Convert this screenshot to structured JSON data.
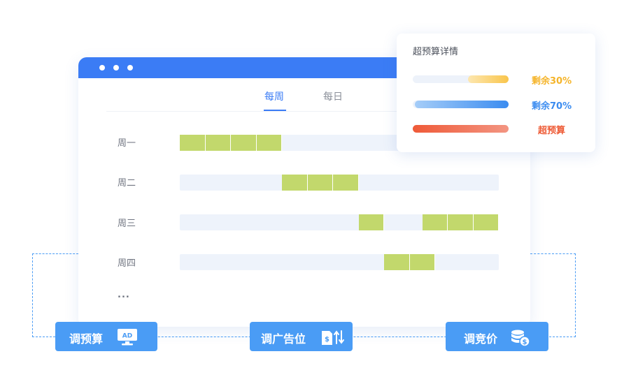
{
  "window": {
    "tabs": [
      {
        "label": "每周",
        "active": true
      },
      {
        "label": "每日",
        "active": false
      }
    ]
  },
  "schedule": {
    "rows": [
      {
        "label": "周一",
        "segments": [
          [
            0,
            4
          ]
        ]
      },
      {
        "label": "周二",
        "segments": [
          [
            4,
            7
          ]
        ]
      },
      {
        "label": "周三",
        "segments": [
          [
            7,
            8
          ],
          [
            9.5,
            12.5
          ]
        ]
      },
      {
        "label": "周四",
        "segments": [
          [
            8,
            10
          ]
        ]
      }
    ],
    "more": "..."
  },
  "budget_popup": {
    "title": "超预算详情",
    "items": [
      {
        "label": "剩余30%",
        "color": "#f5b429",
        "remaining_percent": 30,
        "fill_colors": [
          "#fde7b0",
          "#f9c54c"
        ]
      },
      {
        "label": "剩余70%",
        "color": "#3b8cf0",
        "remaining_percent": 70,
        "fill_colors": [
          "#a5cdf8",
          "#3b8cf0"
        ]
      },
      {
        "label": "超预算",
        "color": "#ee5a35",
        "remaining_percent": 0,
        "fill_colors": [
          "#ef5a38",
          "#f39582"
        ]
      }
    ]
  },
  "actions": {
    "adjust_budget": "调预算",
    "adjust_placement": "调广告位",
    "adjust_bid": "调竞价",
    "ad_icon_text": "AD"
  },
  "colors": {
    "accent": "#3b7cf5",
    "button": "#4a9cf5",
    "cell": "#c2d86c",
    "track": "#eef3fb"
  }
}
